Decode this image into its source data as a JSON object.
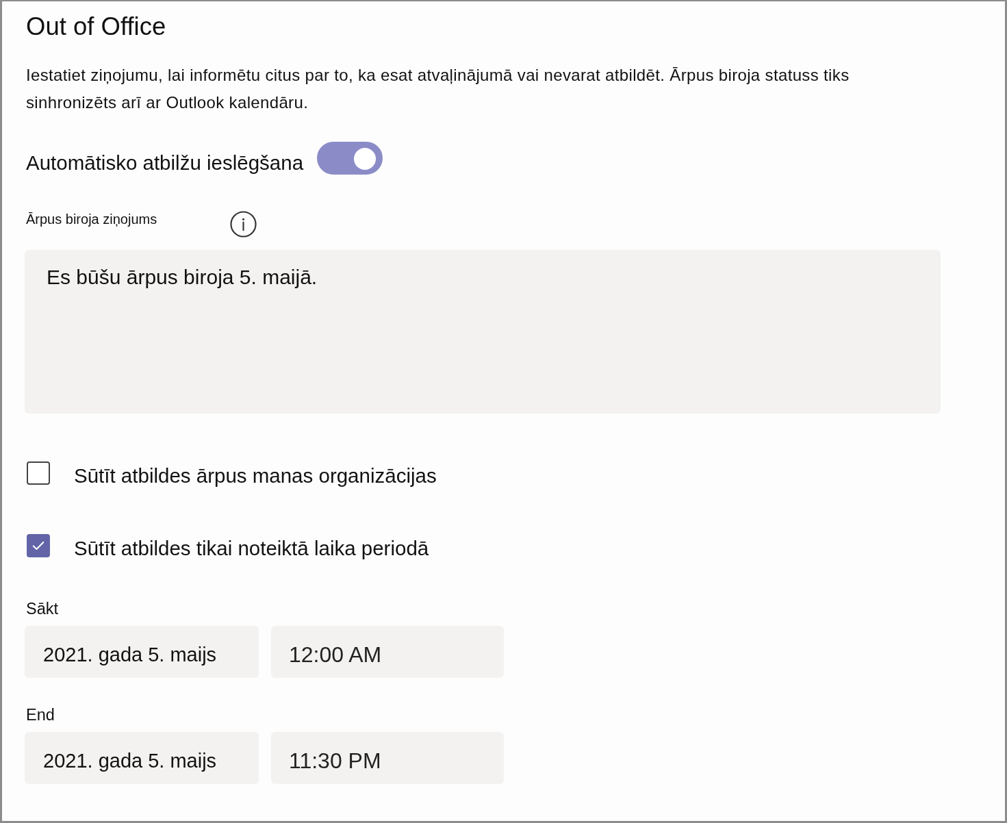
{
  "title": "Out of Office",
  "description": "Iestatiet ziņojumu, lai informētu citus par to, ka esat atvaļinājumā vai nevarat atbildēt. Ārpus biroja statuss tiks sinhronizēts arī ar Outlook kalendāru.",
  "auto_replies": {
    "label": "Automātisko atbilžu ieslēgšana",
    "on": true
  },
  "message": {
    "label": "Ārpus biroja ziņojums",
    "value": "Es būšu ārpus biroja 5. maijā."
  },
  "options": [
    {
      "label": "Sūtīt atbildes ārpus manas organizācijas",
      "checked": false
    },
    {
      "label": "Sūtīt atbildes tikai noteiktā laika periodā",
      "checked": true
    }
  ],
  "period": [
    {
      "label": "Sākt",
      "date": "2021. gada 5. maijs",
      "time": "12:00 AM"
    },
    {
      "label": "End",
      "date": "2021. gada 5. maijs",
      "time": "11:30 PM"
    }
  ]
}
